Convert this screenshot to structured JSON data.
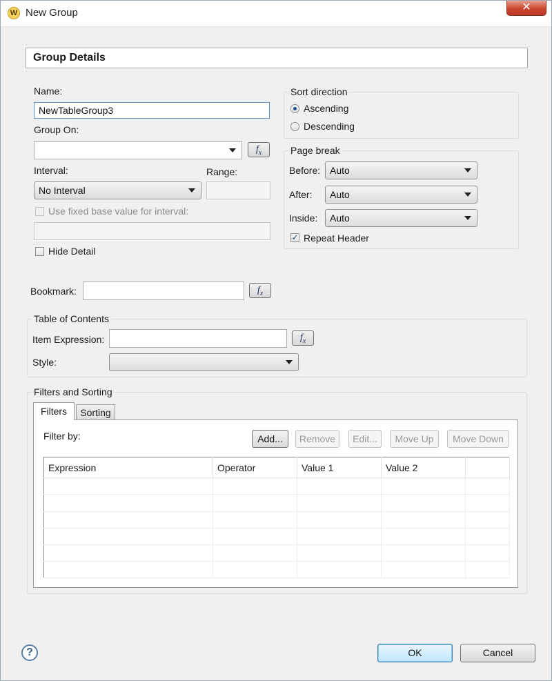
{
  "window": {
    "title": "New Group",
    "app_icon": "W",
    "close": "✕"
  },
  "header": {
    "title": "Group Details"
  },
  "form": {
    "name_label": "Name:",
    "name_value": "NewTableGroup3",
    "group_on_label": "Group On:",
    "group_on_value": "",
    "interval_label": "Interval:",
    "interval_value": "No Interval",
    "range_label": "Range:",
    "range_value": "",
    "fixed_base_label": "Use fixed base value for interval:",
    "fixed_base_value": "",
    "hide_detail_label": "Hide Detail"
  },
  "sort_direction": {
    "title": "Sort direction",
    "ascending": "Ascending",
    "descending": "Descending",
    "selected": "Ascending"
  },
  "page_break": {
    "title": "Page break",
    "before_label": "Before:",
    "before_value": "Auto",
    "after_label": "After:",
    "after_value": "Auto",
    "inside_label": "Inside:",
    "inside_value": "Auto",
    "repeat_header_label": "Repeat Header",
    "repeat_header_checked": true
  },
  "bookmark": {
    "label": "Bookmark:",
    "value": ""
  },
  "toc": {
    "title": "Table of Contents",
    "item_expression_label": "Item Expression:",
    "item_expression_value": "",
    "style_label": "Style:",
    "style_value": ""
  },
  "filters_sorting": {
    "title": "Filters and Sorting",
    "tabs": [
      {
        "label": "Filters",
        "active": true
      },
      {
        "label": "Sorting",
        "active": false
      }
    ],
    "filter_by_label": "Filter by:",
    "buttons": {
      "add": "Add...",
      "remove": "Remove",
      "edit": "Edit...",
      "move_up": "Move Up",
      "move_down": "Move Down"
    },
    "columns": [
      "Expression",
      "Operator",
      "Value 1",
      "Value 2",
      ""
    ]
  },
  "fx": "fx",
  "footer": {
    "ok": "OK",
    "cancel": "Cancel",
    "help": "?"
  }
}
